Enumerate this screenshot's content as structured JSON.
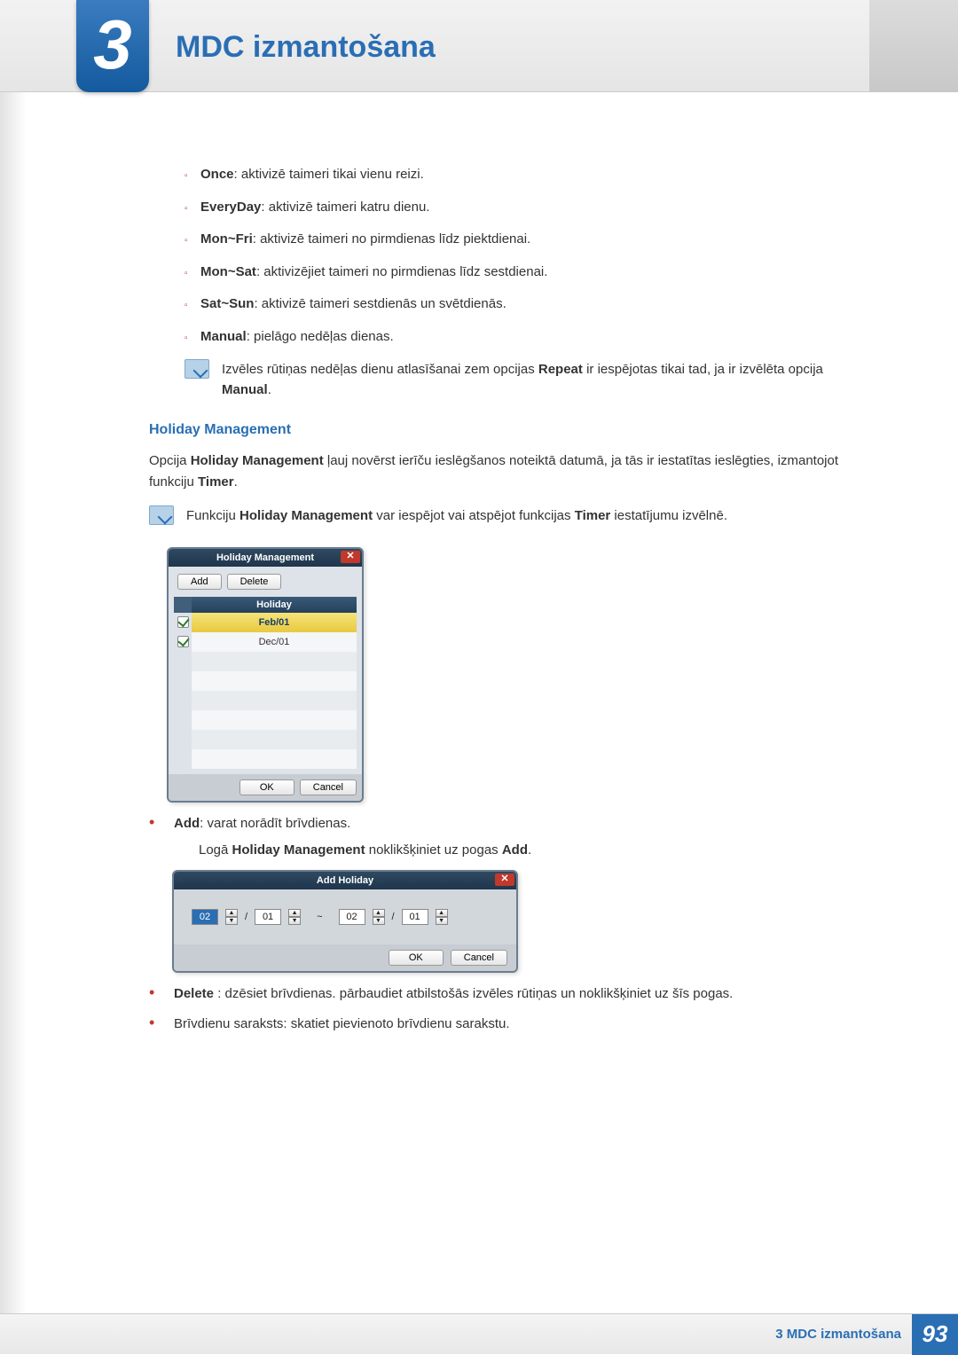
{
  "chapter": {
    "number": "3",
    "title": "MDC izmantošana"
  },
  "bullets": [
    {
      "b": "Once",
      "t": ": aktivizē taimeri tikai vienu reizi."
    },
    {
      "b": "EveryDay",
      "t": ": aktivizē taimeri katru dienu."
    },
    {
      "b": "Mon~Fri",
      "t": ": aktivizē taimeri no pirmdienas līdz piektdienai."
    },
    {
      "b": "Mon~Sat",
      "t": ": aktivizējiet taimeri no pirmdienas līdz sestdienai."
    },
    {
      "b": "Sat~Sun",
      "t": ": aktivizē taimeri sestdienās un svētdienās."
    },
    {
      "b": "Manual",
      "t": ": pielāgo nedēļas dienas."
    }
  ],
  "note1": {
    "pre": "Izvēles rūtiņas nedēļas dienu atlasīšanai zem opcijas ",
    "b1": "Repeat",
    "mid": " ir iespējotas tikai tad, ja ir izvēlēta opcija ",
    "b2": "Manual",
    "post": "."
  },
  "hm": {
    "heading": "Holiday Management",
    "para_pre": "Opcija ",
    "para_b1": "Holiday Management",
    "para_mid": " ļauj novērst ierīču ieslēgšanos noteiktā datumā, ja tās ir iestatītas ieslēgties, izmantojot funkciju ",
    "para_b2": "Timer",
    "para_post": "."
  },
  "note2": {
    "pre": "Funkciju ",
    "b1": "Holiday Management",
    "mid": " var iespējot vai atspējot funkcijas ",
    "b2": "Timer",
    "post": " iestatījumu izvēlnē."
  },
  "hmDialog": {
    "title": "Holiday Management",
    "add": "Add",
    "delete": "Delete",
    "col": "Holiday",
    "rows": [
      "Feb/01",
      "Dec/01"
    ],
    "ok": "OK",
    "cancel": "Cancel"
  },
  "addItem": {
    "b": "Add",
    "t": ": varat norādīt brīvdienas.",
    "sub_pre": "Logā ",
    "sub_b1": "Holiday Management",
    "sub_mid": " noklikšķiniet uz pogas ",
    "sub_b2": "Add",
    "sub_post": "."
  },
  "ahDialog": {
    "title": "Add Holiday",
    "m1": "02",
    "d1": "01",
    "m2": "02",
    "d2": "01",
    "sep": "~",
    "slash": "/",
    "ok": "OK",
    "cancel": "Cancel"
  },
  "deleteItem": {
    "b": "Delete",
    "t": " : dzēsiet brīvdienas. pārbaudiet atbilstošās izvēles rūtiņas un noklikšķiniet uz šīs pogas."
  },
  "listItem": {
    "t": "Brīvdienu saraksts: skatiet pievienoto brīvdienu sarakstu."
  },
  "footer": {
    "text": "3 MDC izmantošana",
    "page": "93"
  }
}
